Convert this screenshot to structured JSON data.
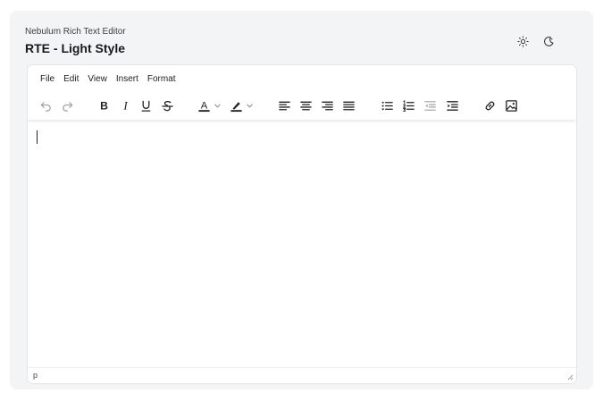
{
  "header": {
    "subtitle": "Nebulum Rich Text Editor",
    "title": "RTE - Light Style"
  },
  "theme_toggle": {
    "light_icon": "sun-icon",
    "dark_icon": "moon-icon"
  },
  "menubar": {
    "items": [
      "File",
      "Edit",
      "View",
      "Insert",
      "Format"
    ]
  },
  "toolbar": {
    "icons": [
      "undo-icon",
      "redo-icon",
      "bold-icon",
      "italic-icon",
      "underline-icon",
      "strikethrough-icon",
      "text-color-icon",
      "highlight-color-icon",
      "align-left-icon",
      "align-center-icon",
      "align-right-icon",
      "align-justify-icon",
      "bullet-list-icon",
      "numbered-list-icon",
      "outdent-icon",
      "indent-icon",
      "link-icon",
      "image-icon"
    ],
    "text_color_letter": "A",
    "bold_letter": "B",
    "italic_letter": "I",
    "underline_letter": "U",
    "strike_letter": "S"
  },
  "editor": {
    "content": ""
  },
  "statusbar": {
    "path": "p"
  },
  "colors": {
    "card_bg": "#f3f4f5",
    "editor_bg": "#ffffff",
    "icon": "#222222",
    "icon_disabled": "#9aa0a6",
    "accent_text_color": "#222222"
  }
}
